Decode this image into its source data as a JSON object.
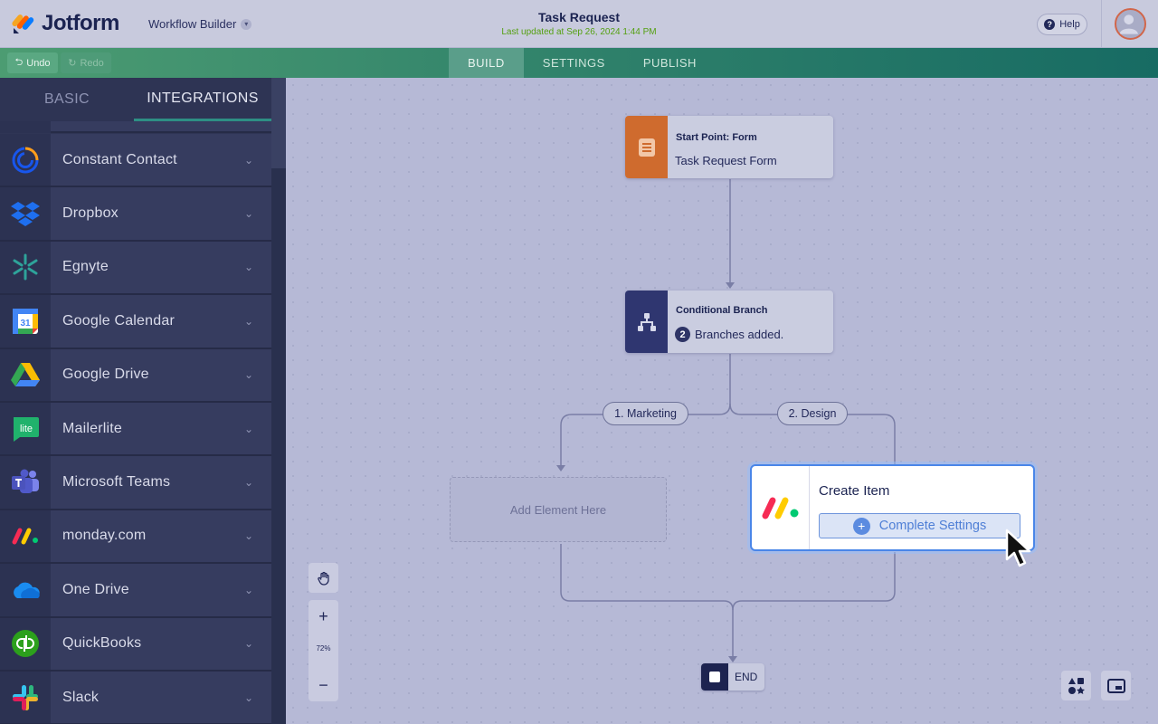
{
  "header": {
    "logo_text": "Jotform",
    "app_switcher": "Workflow Builder",
    "title": "Task Request",
    "last_updated": "Last updated at Sep 26, 2024 1:44 PM",
    "help_label": "Help"
  },
  "toolbar": {
    "undo_label": "Undo",
    "redo_label": "Redo",
    "tabs": [
      {
        "label": "BUILD",
        "active": true
      },
      {
        "label": "SETTINGS",
        "active": false
      },
      {
        "label": "PUBLISH",
        "active": false
      }
    ]
  },
  "sidebar": {
    "tabs": [
      {
        "label": "BASIC",
        "active": false
      },
      {
        "label": "INTEGRATIONS",
        "active": true
      }
    ],
    "items": [
      {
        "label": "Constant Contact",
        "icon": "constant-contact-icon"
      },
      {
        "label": "Dropbox",
        "icon": "dropbox-icon"
      },
      {
        "label": "Egnyte",
        "icon": "egnyte-icon"
      },
      {
        "label": "Google Calendar",
        "icon": "google-calendar-icon"
      },
      {
        "label": "Google Drive",
        "icon": "google-drive-icon"
      },
      {
        "label": "Mailerlite",
        "icon": "mailerlite-icon"
      },
      {
        "label": "Microsoft Teams",
        "icon": "microsoft-teams-icon"
      },
      {
        "label": "monday.com",
        "icon": "monday-icon"
      },
      {
        "label": "One Drive",
        "icon": "onedrive-icon"
      },
      {
        "label": "QuickBooks",
        "icon": "quickbooks-icon"
      },
      {
        "label": "Slack",
        "icon": "slack-icon"
      }
    ],
    "calendar_day": "31",
    "mailerlite_badge": "lite"
  },
  "canvas": {
    "start_node": {
      "title": "Start Point: Form",
      "subtitle": "Task Request Form"
    },
    "conditional_node": {
      "title": "Conditional Branch",
      "count": "2",
      "subtitle": "Branches added."
    },
    "branches": [
      {
        "label": "1. Marketing"
      },
      {
        "label": "2. Design"
      }
    ],
    "placeholder": "Add Element Here",
    "create_item": {
      "title": "Create Item",
      "button": "Complete Settings"
    },
    "end_label": "END",
    "zoom_level": "72%",
    "zoom_in": "+",
    "zoom_out": "−"
  },
  "colors": {
    "accent_green": "#2d7f6a",
    "start_orange": "#cf6b2e",
    "conditional_navy": "#2f3670",
    "selection_blue": "#4a86e8"
  }
}
